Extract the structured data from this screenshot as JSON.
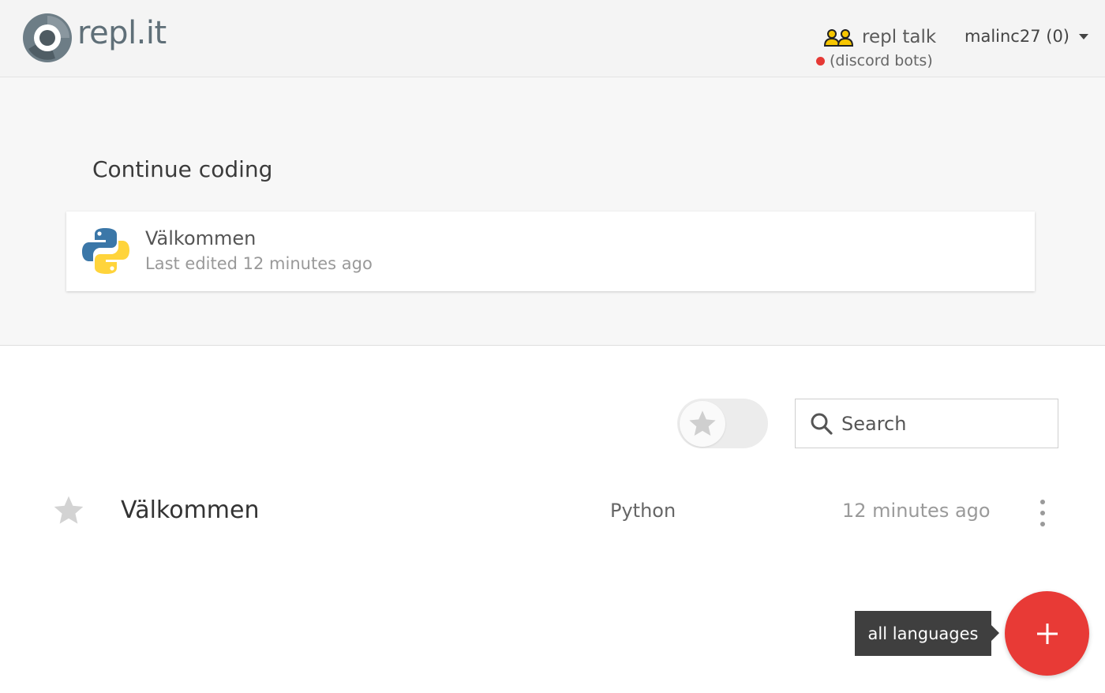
{
  "header": {
    "logo_text": "repl.it",
    "talk_label": "repl talk",
    "talk_sub": "(discord bots)",
    "user_label": "malinc27 (0)"
  },
  "continue": {
    "title": "Continue coding",
    "card": {
      "name": "Välkommen",
      "subtitle": "Last edited 12 minutes ago",
      "icon": "python-icon"
    }
  },
  "filter": {
    "search_placeholder": "Search",
    "toggle_icon": "star-icon"
  },
  "repls": [
    {
      "name": "Välkommen",
      "language": "Python",
      "time": "12 minutes ago"
    }
  ],
  "fab": {
    "tooltip": "all languages",
    "icon": "plus-icon"
  },
  "colors": {
    "accent": "#e83a36",
    "status_dot": "#e53935",
    "tooltip_bg": "#3f3f3f"
  }
}
